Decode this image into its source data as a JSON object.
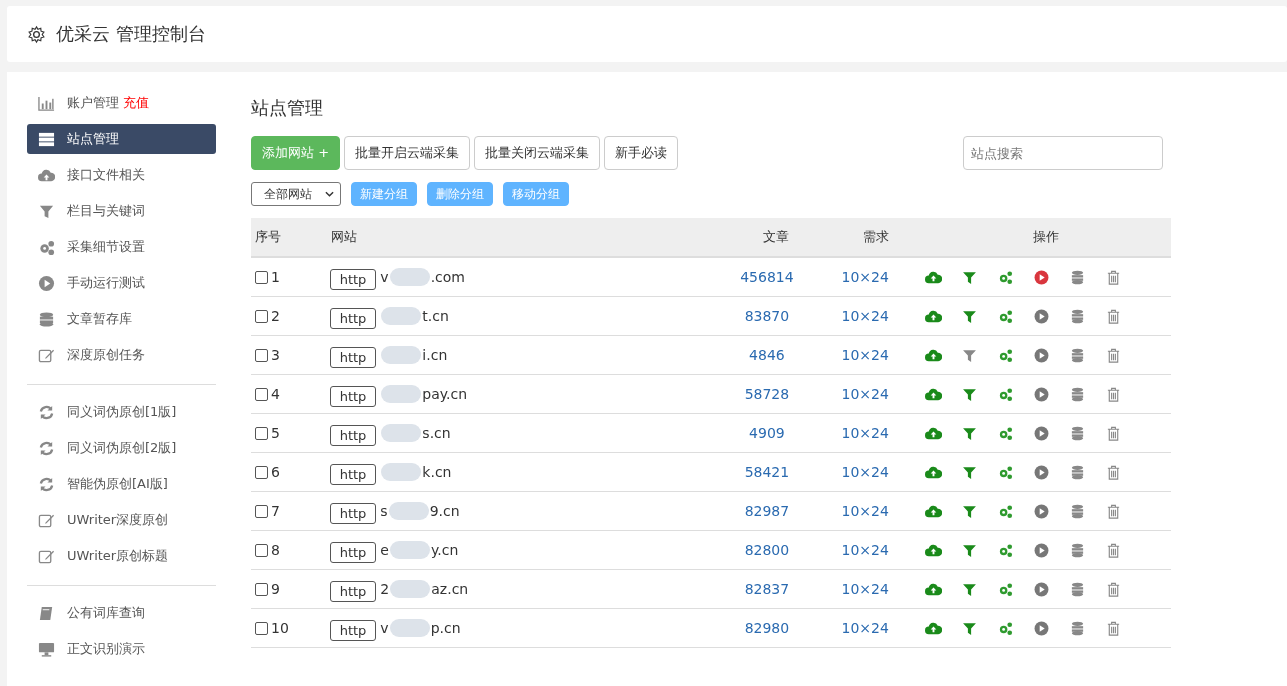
{
  "header": {
    "title": "优采云 管理控制台"
  },
  "sidebar": {
    "groups": [
      [
        {
          "label": "账户管理",
          "badge": "充值",
          "selected": false
        },
        {
          "label": "站点管理",
          "selected": true
        },
        {
          "label": "接口文件相关",
          "selected": false
        },
        {
          "label": "栏目与关键词",
          "selected": false
        },
        {
          "label": "采集细节设置",
          "selected": false
        },
        {
          "label": "手动运行测试",
          "selected": false
        },
        {
          "label": "文章暂存库",
          "selected": false
        },
        {
          "label": "深度原创任务",
          "selected": false
        }
      ],
      [
        {
          "label": "同义词伪原创[1版]",
          "selected": false
        },
        {
          "label": "同义词伪原创[2版]",
          "selected": false
        },
        {
          "label": "智能伪原创[AI版]",
          "selected": false
        },
        {
          "label": "UWriter深度原创",
          "selected": false
        },
        {
          "label": "UWriter原创标题",
          "selected": false
        }
      ],
      [
        {
          "label": "公有词库查询",
          "selected": false
        },
        {
          "label": "正文识别演示",
          "selected": false
        }
      ]
    ]
  },
  "page_title": "站点管理",
  "toolbar": {
    "add_button": "添加网站 +",
    "buttons": [
      "批量开启云端采集",
      "批量关闭云端采集",
      "新手必读"
    ],
    "search": {
      "placeholder": "站点搜索"
    }
  },
  "group_bar": {
    "select": "全部网站",
    "buttons": [
      "新建分组",
      "删除分组",
      "移动分组"
    ]
  },
  "table": {
    "columns": [
      "序号",
      "网站",
      "文章",
      "需求",
      "操作"
    ],
    "rows": [
      {
        "checked": false,
        "index": "1",
        "scheme": "http",
        "site_start": "v",
        "site_end": ".com",
        "articles": "456814",
        "demand": "10×24",
        "filter_on": true,
        "running": true
      },
      {
        "checked": false,
        "index": "2",
        "scheme": "http",
        "site_start": "",
        "site_end": "t.cn",
        "articles": "83870",
        "demand": "10×24",
        "filter_on": true,
        "running": false
      },
      {
        "checked": false,
        "index": "3",
        "scheme": "http",
        "site_start": "",
        "site_end": "i.cn",
        "articles": "4846",
        "demand": "10×24",
        "filter_on": false,
        "running": false
      },
      {
        "checked": false,
        "index": "4",
        "scheme": "http",
        "site_start": "",
        "site_end": "pay.cn",
        "articles": "58728",
        "demand": "10×24",
        "filter_on": true,
        "running": false
      },
      {
        "checked": false,
        "index": "5",
        "scheme": "http",
        "site_start": "",
        "site_end": "s.cn",
        "articles": "4909",
        "demand": "10×24",
        "filter_on": true,
        "running": false
      },
      {
        "checked": false,
        "index": "6",
        "scheme": "http",
        "site_start": "",
        "site_end": "k.cn",
        "articles": "58421",
        "demand": "10×24",
        "filter_on": true,
        "running": false
      },
      {
        "checked": false,
        "index": "7",
        "scheme": "http",
        "site_start": "s",
        "site_end": "9.cn",
        "articles": "82987",
        "demand": "10×24",
        "filter_on": true,
        "running": false
      },
      {
        "checked": false,
        "index": "8",
        "scheme": "http",
        "site_start": "e",
        "site_end": "y.cn",
        "articles": "82800",
        "demand": "10×24",
        "filter_on": true,
        "running": false
      },
      {
        "checked": false,
        "index": "9",
        "scheme": "http",
        "site_start": "2",
        "site_end": "az.cn",
        "articles": "82837",
        "demand": "10×24",
        "filter_on": true,
        "running": false
      },
      {
        "checked": false,
        "index": "10",
        "scheme": "http",
        "site_start": "v",
        "site_end": "p.cn",
        "articles": "82980",
        "demand": "10×24",
        "filter_on": true,
        "running": false
      }
    ]
  }
}
